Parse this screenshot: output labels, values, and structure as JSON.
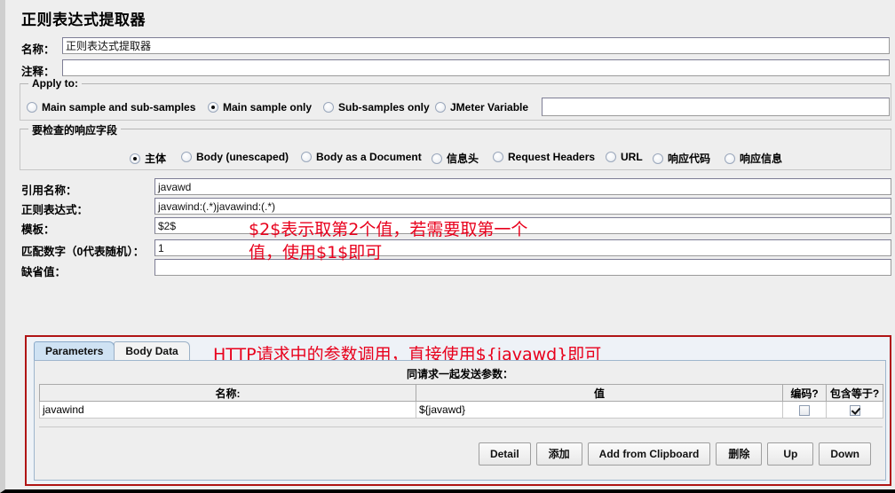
{
  "window": {
    "title": "正则表达式提取器"
  },
  "form": {
    "name_label": "名称：",
    "name_value": "正则表达式提取器",
    "comment_label": "注释：",
    "comment_value": ""
  },
  "apply_to": {
    "legend": "Apply to:",
    "options": [
      {
        "label": "Main sample and sub-samples",
        "selected": false
      },
      {
        "label": "Main sample only",
        "selected": true
      },
      {
        "label": "Sub-samples only",
        "selected": false
      },
      {
        "label": "JMeter Variable",
        "selected": false
      }
    ],
    "variable_value": ""
  },
  "field_to_check": {
    "legend": "要检查的响应字段",
    "options": [
      {
        "label": "主体",
        "selected": true
      },
      {
        "label": "Body (unescaped)",
        "selected": false
      },
      {
        "label": "Body as a Document",
        "selected": false
      },
      {
        "label": "信息头",
        "selected": false
      },
      {
        "label": "Request Headers",
        "selected": false
      },
      {
        "label": "URL",
        "selected": false
      },
      {
        "label": "响应代码",
        "selected": false
      },
      {
        "label": "响应信息",
        "selected": false
      }
    ]
  },
  "extractor": {
    "ref_name_label": "引用名称：",
    "ref_name_value": "javawd",
    "regex_label": "正则表达式：",
    "regex_value": "javawind:(.*)javawind:(.*)",
    "template_label": "模板：",
    "template_value": "$2$",
    "match_no_label": "匹配数字（0代表随机）：",
    "match_no_value": "1",
    "default_label": "缺省值：",
    "default_value": ""
  },
  "annotations": {
    "template_note_line1": "$2$表示取第2个值，若需要取第一个",
    "template_note_line2": "值，使用$1$即可",
    "http_note": "HTTP请求中的参数调用，直接使用${javawd}即可"
  },
  "http_panel": {
    "tabs": [
      {
        "label": "Parameters",
        "active": true
      },
      {
        "label": "Body Data",
        "active": false
      }
    ],
    "send_with_request_label": "同请求一起发送参数：",
    "table": {
      "columns": [
        "名称:",
        "值",
        "编码?",
        "包含等于?"
      ],
      "rows": [
        {
          "name": "javawind",
          "value": "${javawd}",
          "encode": false,
          "include_equals": true
        }
      ]
    },
    "buttons": [
      "Detail",
      "添加",
      "Add from Clipboard",
      "删除",
      "Up",
      "Down"
    ]
  },
  "colors": {
    "annotation": "#e8001c",
    "panel_border": "#b01414",
    "tab_active": "#cfe2f3"
  }
}
